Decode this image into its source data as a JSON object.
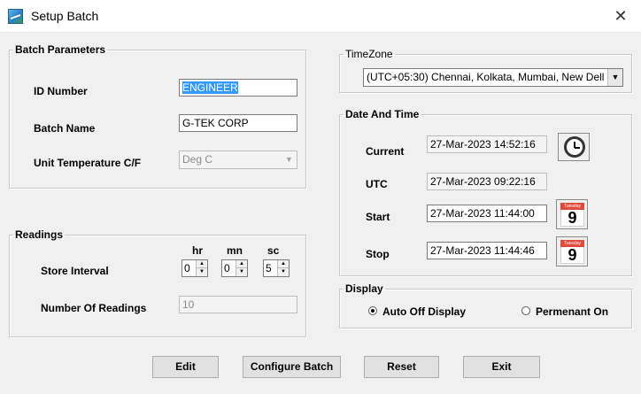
{
  "window": {
    "title": "Setup Batch",
    "close_glyph": "✕"
  },
  "batch_parameters": {
    "legend": "Batch Parameters",
    "id_number_label": "ID Number",
    "id_number_value": "ENGINEER",
    "batch_name_label": "Batch Name",
    "batch_name_value": "G-TEK CORP",
    "unit_temperature_label": "Unit Temperature C/F",
    "unit_temperature_value": "Deg C"
  },
  "readings": {
    "legend": "Readings",
    "col_hr": "hr",
    "col_mn": "mn",
    "col_sc": "sc",
    "store_interval_label": "Store Interval",
    "store_interval_hr": "0",
    "store_interval_mn": "0",
    "store_interval_sc": "5",
    "number_of_readings_label": "Number Of Readings",
    "number_of_readings_value": "10"
  },
  "timezone": {
    "legend": "TimeZone",
    "selected": "(UTC+05:30) Chennai, Kolkata, Mumbai, New Dell"
  },
  "date_and_time": {
    "legend": "Date And Time",
    "current_label": "Current",
    "current_value": "27-Mar-2023 14:52:16",
    "utc_label": "UTC",
    "utc_value": "27-Mar-2023 09:22:16",
    "start_label": "Start",
    "start_value": "27-Mar-2023 11:44:00",
    "stop_label": "Stop",
    "stop_value": "27-Mar-2023 11:44:46",
    "calendar_day_name": "Tuesday",
    "calendar_day_number": "9"
  },
  "display": {
    "legend": "Display",
    "auto_off_label": "Auto Off Display",
    "permanent_on_label": "Permenant On",
    "selected": "auto_off"
  },
  "buttons": {
    "edit": "Edit",
    "configure_batch": "Configure Batch",
    "reset": "Reset",
    "exit": "Exit"
  },
  "icons": {
    "app": "app-logo-icon",
    "clock": "clock-icon",
    "calendar": "calendar-icon"
  },
  "colors": {
    "selection_highlight": "#3399ff",
    "calendar_header": "#e04a3a",
    "window_background": "#f0f0f0"
  }
}
